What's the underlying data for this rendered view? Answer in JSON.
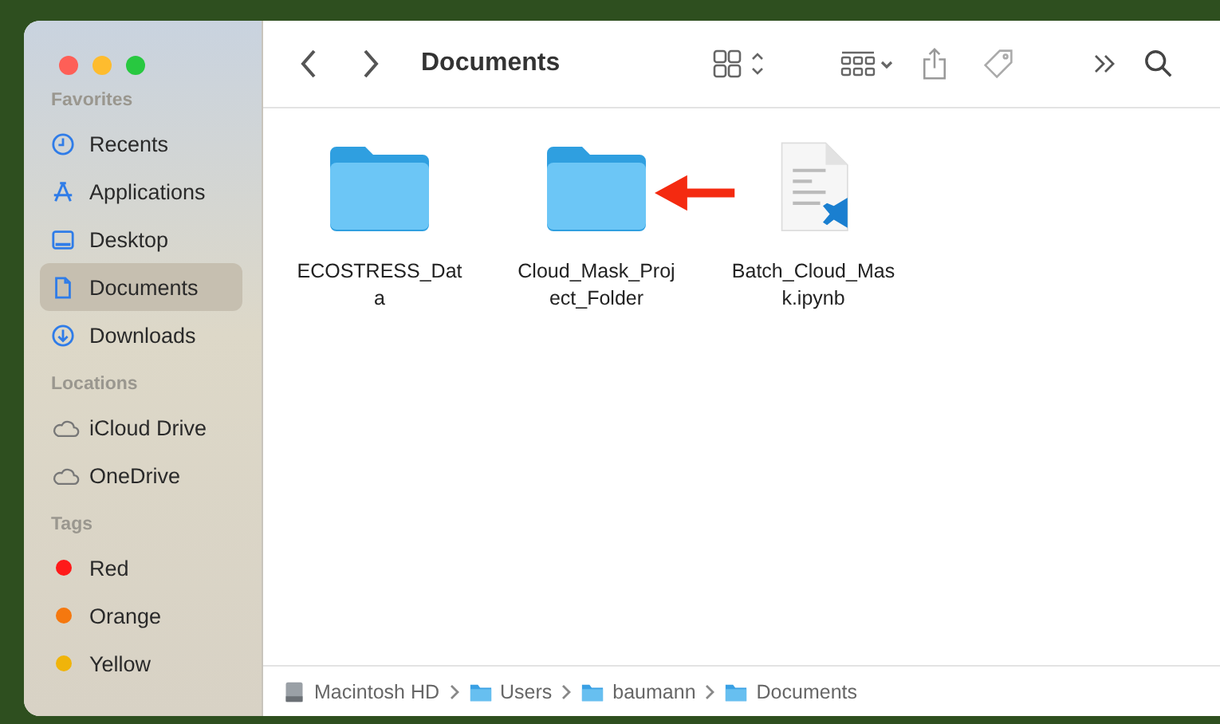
{
  "window": {
    "title": "Documents"
  },
  "sidebar": {
    "sections": [
      {
        "heading": "Favorites",
        "items": [
          {
            "label": "Recents",
            "kind": "clock",
            "selected": false
          },
          {
            "label": "Applications",
            "kind": "apps",
            "selected": false
          },
          {
            "label": "Desktop",
            "kind": "desktop",
            "selected": false
          },
          {
            "label": "Documents",
            "kind": "document",
            "selected": true
          },
          {
            "label": "Downloads",
            "kind": "download",
            "selected": false
          }
        ]
      },
      {
        "heading": "Locations",
        "items": [
          {
            "label": "iCloud Drive",
            "kind": "cloud",
            "selected": false
          },
          {
            "label": "OneDrive",
            "kind": "cloud",
            "selected": false
          }
        ]
      },
      {
        "heading": "Tags",
        "items": [
          {
            "label": "Red",
            "kind": "tag",
            "color": "#ff1a1a",
            "selected": false
          },
          {
            "label": "Orange",
            "kind": "tag",
            "color": "#f5780f",
            "selected": false
          },
          {
            "label": "Yellow",
            "kind": "tag",
            "color": "#f0b40a",
            "selected": false
          }
        ]
      }
    ]
  },
  "files": [
    {
      "kind": "folder",
      "name_lines": [
        "ECOSTRESS_Dat",
        "a"
      ]
    },
    {
      "kind": "folder",
      "name_lines": [
        "Cloud_Mask_Proj",
        "ect_Folder"
      ]
    },
    {
      "kind": "notebook",
      "name_lines": [
        "Batch_Cloud_Mas",
        "k.ipynb"
      ]
    }
  ],
  "path_bar": [
    {
      "label": "Macintosh HD",
      "kind": "disk"
    },
    {
      "label": "Users",
      "kind": "folder"
    },
    {
      "label": "baumann",
      "kind": "folder"
    },
    {
      "label": "Documents",
      "kind": "folder"
    }
  ]
}
